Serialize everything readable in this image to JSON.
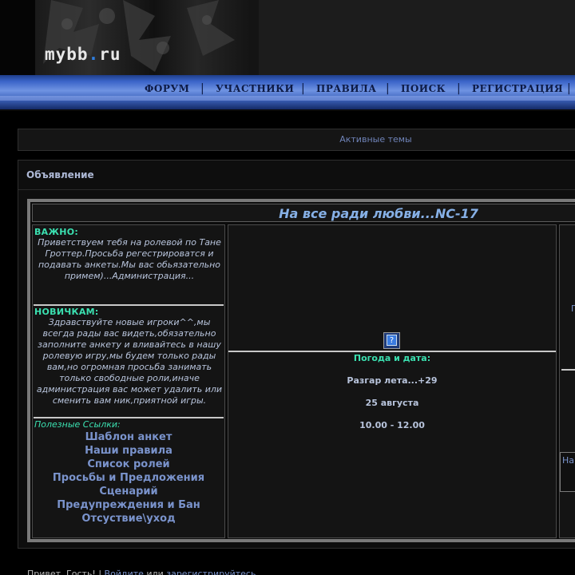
{
  "header": {
    "logo_main": "mybb",
    "logo_dot": ".",
    "logo_tld": "ru"
  },
  "nav": {
    "items": [
      "ФОРУМ",
      "УЧАСТНИКИ",
      "ПРАВИЛА",
      "ПОИСК",
      "РЕГИСТРАЦИЯ"
    ],
    "separator": "|"
  },
  "active_topics": "Активные темы",
  "announcement": {
    "title": "Объявление",
    "main_title": "На все ради любви...NC-17",
    "important_header": "ВАЖНО:",
    "important_text": "Приветствуем тебя на ролевой по Тане Гроттер.Просьба регестрироватся и подавать анкеты.Мы вас обьязательно примем)...Администрация...",
    "newbies_header": "НОВИЧКАМ:",
    "newbies_text": "Здравствуйте новые игроки^^,мы всегда рады вас видеть,обязательно заполните анкету и вливайтесь в нашу ролевую игру,мы будем только рады вам,но огромная просьба занимать только свободные роли,иначе администрация вас может удалить или сменить вам ник,приятной игры.",
    "links_header": "Полезные Ссылки:",
    "links": [
      "Шаблон анкет",
      "Наши правила",
      "Список ролей",
      "Просьбы и Предложения",
      "Сценарий",
      "Предупреждения и Бан",
      "Отсуствие\\уход"
    ],
    "weather_header": "Погода и дата:",
    "weather": "Разгар лета...+29",
    "date": "25 августа",
    "time": "10.00 - 12.00",
    "right_glyph": "П",
    "right_box_text": "На"
  },
  "footer": {
    "greeting": "Привет, Гость! ",
    "sep": "| ",
    "login": "Войдите",
    "or": " или ",
    "register": "зарегистрируйтесь."
  },
  "colors": {
    "accent": "#3be0b0",
    "link": "#7a93cc",
    "title": "#86b0e6",
    "nav": "#3a64c8"
  }
}
